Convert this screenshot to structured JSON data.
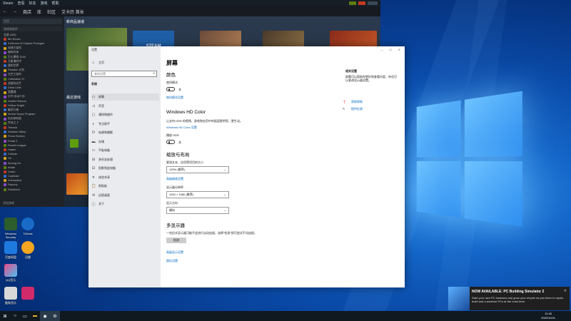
{
  "colors": {
    "desktop_accent": "#1466c8",
    "steam_bg": "#1b2838",
    "settings_link": "#0067c0"
  },
  "steam": {
    "menu": [
      "Steam",
      "查看",
      "好友",
      "游戏",
      "帮助"
    ],
    "nav": [
      "商店",
      "库",
      "社区",
      "艾卡历 首长"
    ],
    "search_placeholder": "主页",
    "sidebar_filter": "游戏和软件",
    "main_header": "新商品速递",
    "tile_label": "STEAM",
    "recent_header": "最近游戏",
    "games": [
      "全部 (183)",
      "88 Heroes",
      "A Memoir of Chapter Prologue",
      "孤独大冒险",
      "模拟农场",
      "巴士模拟 2018",
      "大航海时代",
      "我的世界",
      "Paradox 计划",
      "太空工程师",
      "Civilization VI",
      "消逝的光芒",
      "Dead Cells",
      "恶魔城",
      "尼尔:自动人形",
      "Gunfire Reborn",
      "Hollow Knight",
      "幽灵行者",
      "Kerbal Space Program",
      "饥荒联机版",
      "传说之下",
      "Terraria",
      "Stardew Valley",
      "Forza Horizon",
      "Portal 2",
      "Rocket League",
      "Hades",
      "Celeste",
      "Ori",
      "Among Us",
      "Inside",
      "Limbo",
      "Cuphead",
      "Subnautica",
      "Factorio",
      "RimWorld"
    ],
    "add_game": "添加游戏"
  },
  "settings": {
    "window_title": "设置",
    "search_placeholder": "查找设置",
    "nav": [
      {
        "icon": "⌂",
        "label": "主页"
      },
      {
        "icon": "",
        "label": "系统"
      },
      {
        "icon": "▭",
        "label": "屏幕"
      },
      {
        "icon": "◁",
        "label": "声音"
      },
      {
        "icon": "▢",
        "label": "通知和操作"
      },
      {
        "icon": "◐",
        "label": "专注助手"
      },
      {
        "icon": "⏻",
        "label": "电源和睡眠"
      },
      {
        "icon": "▬",
        "label": "存储"
      },
      {
        "icon": "▭",
        "label": "平板电脑"
      },
      {
        "icon": "⊟",
        "label": "多任务处理"
      },
      {
        "icon": "⊡",
        "label": "投影到此电脑"
      },
      {
        "icon": "✕",
        "label": "体验共享"
      },
      {
        "icon": "📋",
        "label": "剪贴板"
      },
      {
        "icon": "⟲",
        "label": "远程桌面"
      },
      {
        "icon": "ⓘ",
        "label": "关于"
      }
    ],
    "page_title": "屏幕",
    "color_section": "颜色",
    "night_light_label": "夜间模式",
    "night_light_state": "关",
    "night_light_link": "夜间模式设置",
    "hdr_section": "Windows HD Color",
    "hdr_desc": "让支持 HDR 的视频、游戏和应用中的画面更明亮、更生动。",
    "hdr_link": "Windows HD Color 设置",
    "hdr_toggle_label": "播放 HDR",
    "hdr_toggle_state": "关",
    "scale_section": "缩放与布局",
    "scale_label": "更改文本、应用等项目的大小",
    "scale_value": "125% (推荐)",
    "scale_link": "高级缩放设置",
    "resolution_label": "显示器分辨率",
    "resolution_value": "1920 × 1080 (推荐)",
    "orientation_label": "显示方向",
    "orientation_value": "横向",
    "multi_section": "多显示器",
    "multi_desc": "一些旧式显示器可能不会进行自动连接。选择\"检测\"即可尝试手动连接。",
    "detect_button": "检测",
    "advanced_link": "高级显示设置",
    "graphics_link": "图形设置",
    "side_title": "相关设置",
    "side_desc": "屏幕可以帮助你更好地查看内容，你也可以更改显示器设置。",
    "help_link": "获取帮助",
    "feedback_link": "提供反馈"
  },
  "notification": {
    "title": "NOW AVAILABLE: PC Building Simulator 2",
    "body": "Start your own PC business and grow your empire as you learn to repair, build and customize PCs at the most level."
  },
  "taskbar": {
    "time": "11:40",
    "date": "2022/10/11"
  },
  "desktop_icons": [
    "Windows Security",
    "ToDesk",
    "百度网盘",
    "迅雷",
    "QQ音乐",
    "酷狗音乐"
  ]
}
